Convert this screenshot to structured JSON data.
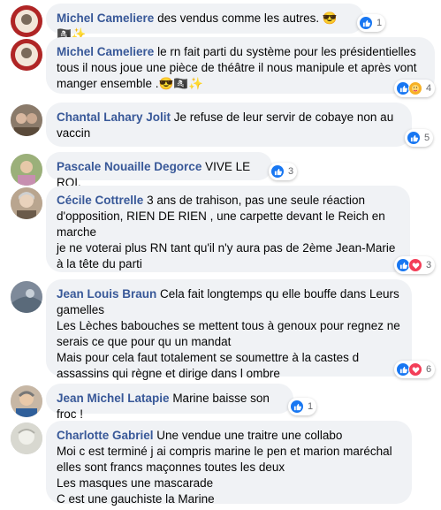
{
  "comments": [
    {
      "author": "Michel Cameliere",
      "text": "des vendus comme les autres. 😎🏴‍☠️✨",
      "reactions": [
        "like"
      ],
      "count": "1"
    },
    {
      "author": "Michel Cameliere",
      "text": "le rn fait parti du système pour les présidentielles tous il nous joue une pièce de théâtre il nous manipule et après vont manger ensemble .😎🏴‍☠️✨",
      "reactions": [
        "like",
        "care"
      ],
      "count": "4"
    },
    {
      "author": "Chantal Lahary Jolit",
      "text": "Je refuse de leur servir de cobaye non au vaccin",
      "reactions": [
        "like"
      ],
      "count": "5"
    },
    {
      "author": "Pascale Nouaille Degorce",
      "text": "VIVE LE ROI.",
      "reactions": [
        "like"
      ],
      "count": "3"
    },
    {
      "author": "Cécile Cottrelle",
      "text": "3 ans de trahison, pas une seule réaction d'opposition, RIEN DE RIEN , une carpette devant le Reich en marche\nje ne voterai plus RN tant qu'il n'y aura pas de 2ème Jean-Marie à la tête du parti",
      "reactions": [
        "like",
        "love"
      ],
      "count": "3"
    },
    {
      "author": "Jean Louis Braun",
      "text": "Cela fait longtemps qu elle bouffe dans Leurs gamelles\nLes Lèches babouches se mettent tous à genoux pour regnez ne serais ce que pour qu un mandat\nMais pour cela faut totalement se soumettre à la castes d assassins qui règne et dirige dans l ombre",
      "reactions": [
        "like",
        "love"
      ],
      "count": "6"
    },
    {
      "author": "Jean Michel Latapie",
      "text": "Marine baisse son froc !",
      "reactions": [
        "like"
      ],
      "count": "1"
    },
    {
      "author": "Charlotte Gabriel",
      "text": "Une vendue une traitre une collabo\nMoi c est terminé j ai compris marine le pen et marion maréchal elles sont francs maçonnes toutes les deux\nLes masques une mascarade\nC est une gauchiste la Marine",
      "reactions": [],
      "count": ""
    }
  ],
  "colors": {
    "author": "#385898",
    "bubble": "#f0f2f5",
    "like": "#1877f2",
    "love": "#f33e58",
    "care": "#f7b125"
  }
}
